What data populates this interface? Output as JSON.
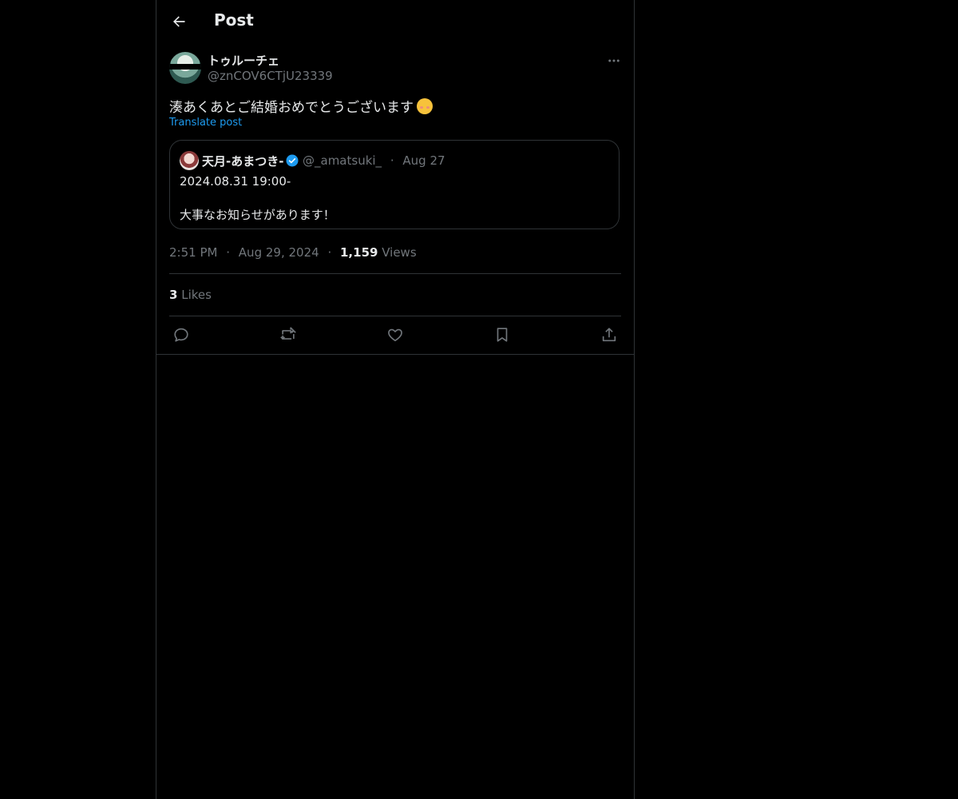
{
  "header": {
    "title": "Post",
    "back_icon": "arrow-left-icon"
  },
  "post": {
    "author": {
      "display_name": "トゥルーチェ",
      "handle": "@znCOV6CTjU23339"
    },
    "text": "湊あくあとご結婚おめでとうございます",
    "emoji": "smiling-blushing-emoji",
    "translate_label": "Translate post",
    "quoted": {
      "display_name": "天月-あまつき-",
      "handle": "@_amatsuki_",
      "separator": "·",
      "date": "Aug 27",
      "line1": "2024.08.31 19:00-",
      "line2": "大事なお知らせがあります！"
    },
    "time": "2:51 PM",
    "date": "Aug 29, 2024",
    "separator": "·",
    "views_count": "1,159",
    "views_label": "Views",
    "likes_count": "3",
    "likes_label": "Likes"
  },
  "actions": [
    "reply-icon",
    "repost-icon",
    "like-icon",
    "bookmark-icon",
    "share-icon"
  ],
  "colors": {
    "background": "#000000",
    "text": "#e7e9ea",
    "muted": "#71767b",
    "accent": "#1d9bf0",
    "border": "#2f3336"
  }
}
